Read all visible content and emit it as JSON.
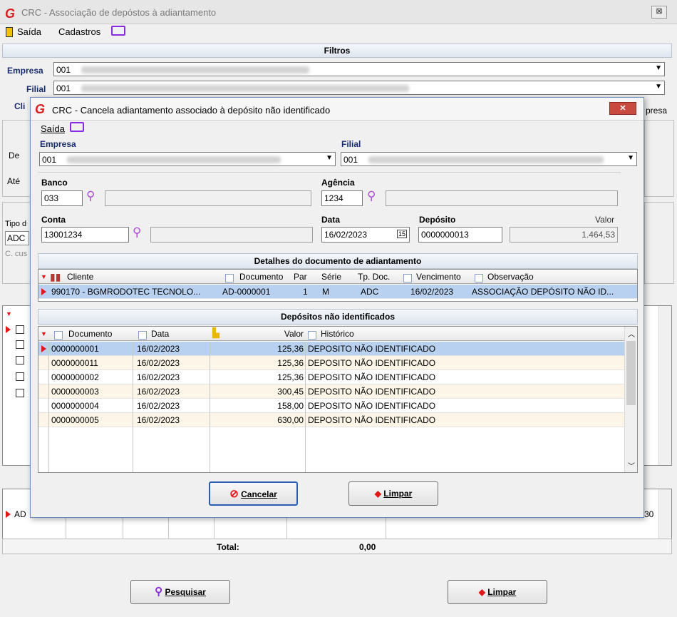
{
  "main": {
    "title": "CRC - Associação de depóstos à adiantamento",
    "menu": {
      "exit": "Saída",
      "register": "Cadastros"
    },
    "filters_header": "Filtros",
    "company_label": "Empresa",
    "company_value": "001",
    "branch_label": "Filial",
    "branch_value": "001",
    "client_label_partial": "Cli",
    "company_suffix_partial": "presa",
    "from_label": "De",
    "to_label": "Até",
    "doc_type_label_partial": "Tipo d",
    "doc_type_value_partial": "ADC",
    "cost_center_partial": "C. cus",
    "lower_row_partial": "AD",
    "lower_row_right_partial": "30",
    "total_label": "Total:",
    "total_value": "0,00",
    "search_button": "Pesquisar",
    "clear_button": "Limpar"
  },
  "dialog": {
    "title": "CRC - Cancela adiantamento associado à depósito não identificado",
    "menu_exit": "Saída",
    "company_label": "Empresa",
    "company_value": "001",
    "branch_label": "Filial",
    "branch_value": "001",
    "bank_label": "Banco",
    "bank_value": "033",
    "agency_label": "Agência",
    "agency_value": "1234",
    "account_label": "Conta",
    "account_value": "13001234",
    "date_label": "Data",
    "date_value": "16/02/2023",
    "deposit_label": "Depósito",
    "deposit_value": "0000000013",
    "value_label": "Valor",
    "value_value": "1.464,53",
    "doc_section_header": "Detalhes do documento de adiantamento",
    "doc_columns": [
      "Cliente",
      "Documento",
      "Par",
      "Série",
      "Tp. Doc.",
      "Vencimento",
      "Observação"
    ],
    "doc_row": {
      "client": "990170 - BGMRODOTEC TECNOLO...",
      "document": "AD-0000001",
      "par": "1",
      "series": "M",
      "doc_type": "ADC",
      "due": "16/02/2023",
      "note": "ASSOCIAÇÃO DEPÓSITO NÃO ID..."
    },
    "deposits_header": "Depósitos não identificados",
    "deposit_columns": [
      "Documento",
      "Data",
      "Valor",
      "Histórico"
    ],
    "deposits": [
      {
        "doc": "0000000001",
        "date": "16/02/2023",
        "value": "125,36",
        "history": "DEPOSITO NÃO IDENTIFICADO"
      },
      {
        "doc": "0000000011",
        "date": "16/02/2023",
        "value": "125,36",
        "history": "DEPOSITO NÃO IDENTIFICADO"
      },
      {
        "doc": "0000000002",
        "date": "16/02/2023",
        "value": "125,36",
        "history": "DEPOSITO NÃO IDENTIFICADO"
      },
      {
        "doc": "0000000003",
        "date": "16/02/2023",
        "value": "300,45",
        "history": "DEPOSITO NÃO IDENTIFICADO"
      },
      {
        "doc": "0000000004",
        "date": "16/02/2023",
        "value": "158,00",
        "history": "DEPOSITO NÃO IDENTIFICADO"
      },
      {
        "doc": "0000000005",
        "date": "16/02/2023",
        "value": "630,00",
        "history": "DEPOSITO NÃO IDENTIFICADO"
      }
    ],
    "cancel_button": "Cancelar",
    "clear_button": "Limpar",
    "calendar_glyph": "15"
  },
  "colors": {
    "selected_row": "#b9d1f0",
    "alt_row": "#fdf6e8",
    "brand_red": "#d81e1e",
    "purple_icon": "#8a2be2"
  }
}
